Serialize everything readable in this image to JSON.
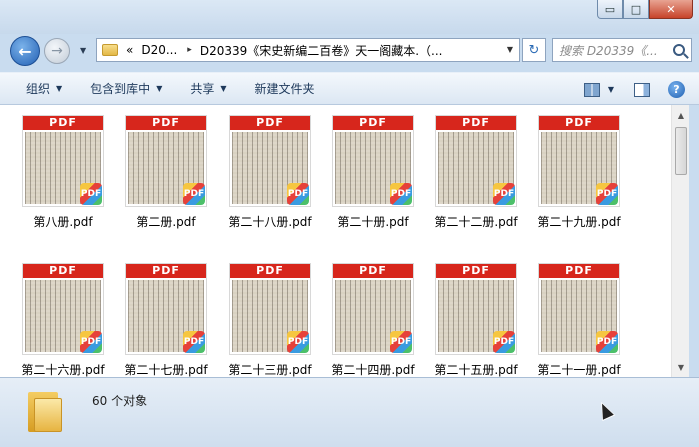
{
  "window": {
    "min_glyph": "▭",
    "max_glyph": "□",
    "close_glyph": "✕"
  },
  "nav": {
    "back_glyph": "←",
    "forward_glyph": "→",
    "history_glyph": "▼"
  },
  "address": {
    "overflow": "«",
    "crumbs": [
      "D20...",
      "D20339《宋史新编二百卷》天一阁藏本.（..."
    ],
    "separator": "▸",
    "dropdown_glyph": "▼",
    "refresh_glyph": "↻"
  },
  "search": {
    "placeholder": "搜索 D20339《..."
  },
  "toolbar": {
    "organize": "组织",
    "include_in_library": "包含到库中",
    "share": "共享",
    "new_folder": "新建文件夹",
    "dropdown_glyph": "▼",
    "help_glyph": "?"
  },
  "files": {
    "thumb_header": "PDF",
    "badge_text": "PDF",
    "items": [
      {
        "name": "第八册.pdf"
      },
      {
        "name": "第二册.pdf"
      },
      {
        "name": "第二十八册.pdf"
      },
      {
        "name": "第二十册.pdf"
      },
      {
        "name": "第二十二册.pdf"
      },
      {
        "name": "第二十九册.pdf"
      },
      {
        "name": "第二十六册.pdf"
      },
      {
        "name": "第二十七册.pdf"
      },
      {
        "name": "第二十三册.pdf"
      },
      {
        "name": "第二十四册.pdf"
      },
      {
        "name": "第二十五册.pdf"
      },
      {
        "name": "第二十一册.pdf"
      }
    ]
  },
  "scrollbar": {
    "up_glyph": "▲",
    "down_glyph": "▼"
  },
  "status": {
    "count_text": "60 个对象"
  },
  "colors": {
    "pdf_red": "#d7261c",
    "chrome_blue": "#c9dcef",
    "toolbar_text": "#1e395b"
  }
}
